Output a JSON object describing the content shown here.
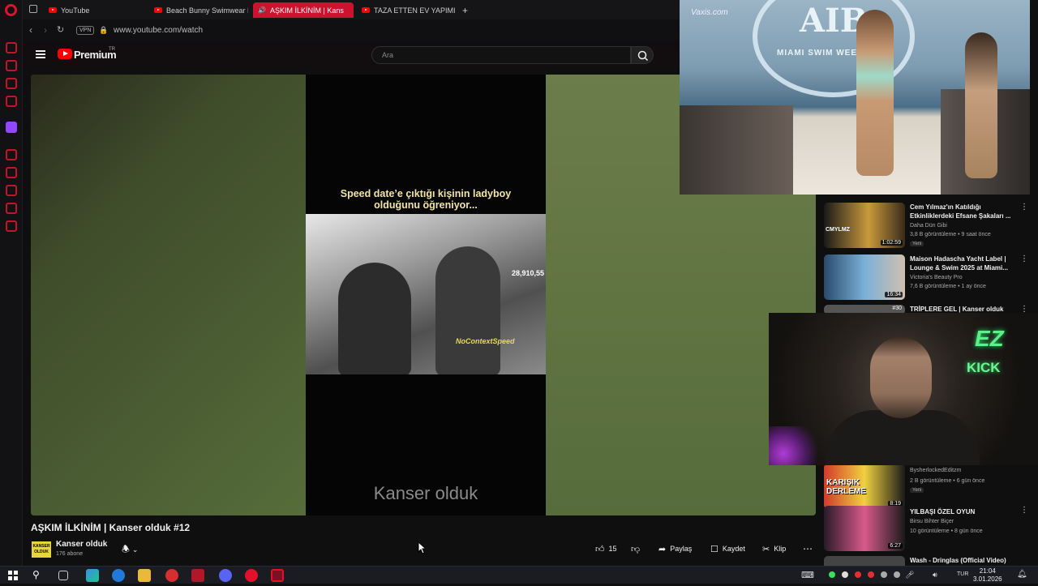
{
  "browser": {
    "tabs": [
      {
        "label": "YouTube",
        "active": false
      },
      {
        "label": "Beach Bunny Swimwear F",
        "active": false
      },
      {
        "label": "AŞKIM İLKİNİM | Kans",
        "active": true
      },
      {
        "label": "TAZA ETTEN EV YAPIMI KC",
        "active": false
      }
    ],
    "new_tab_label": "+",
    "vpn_label": "VPN",
    "url": "www.youtube.com/watch"
  },
  "youtube": {
    "logo_text": "Premium",
    "logo_region": "TR",
    "search_placeholder": "Ara"
  },
  "video": {
    "caption_line1": "Speed date’e çıktığı kişinin ladyboy",
    "caption_line2": "olduğunu öğreniyor...",
    "counter": "28,910,55",
    "overlay_tag": "NoContextSpeed",
    "watermark": "Kanser olduk",
    "title": "AŞKIM İLKİNİM | Kanser olduk #12",
    "channel_name": "Kanser olduk",
    "channel_avatar_text": "KANSER OLDUK",
    "subscribers": "176 abone",
    "likes": "15",
    "share_label": "Paylaş",
    "save_label": "Kaydet",
    "clip_label": "Klip"
  },
  "pip": {
    "banner_text": "AIB",
    "banner_subtext": "MIAMI SWIM WEEK",
    "source_logo": "Vaxis.com"
  },
  "webcam": {
    "overlay_line1": "EZ",
    "overlay_line2": "KICK"
  },
  "recommendations": [
    {
      "title": "Cem Yılmaz'ın Katıldığı Etkinliklerdeki Efsane Şakaları ...",
      "channel": "Daha Dün Gibi",
      "meta": "3,8 B görüntüleme • 9 saat önce",
      "badge": "Yeni",
      "duration": "1:02:59",
      "thumb_text": "CMYLMZ"
    },
    {
      "title": "Maison Hadascha Yacht Label | Lounge & Swim 2025 at Miami...",
      "channel": "Victoria's Beauty Pro",
      "meta": "7,6 B görüntüleme • 1 ay önce",
      "badge": "",
      "duration": "16:34",
      "thumb_text": ""
    },
    {
      "title": "TRİPLERE GEL | Kanser olduk",
      "channel": "",
      "meta": "",
      "badge": "",
      "duration": "",
      "thumb_text": "#30"
    },
    {
      "title": "",
      "channel": "BysherlockedEditzm",
      "meta": "2 B görüntüleme • 6 gün önce",
      "badge": "Yeni",
      "duration": "8:19",
      "thumb_text": "KARIŞIK DERLEME"
    },
    {
      "title": "YILBAŞI ÖZEL OYUN",
      "channel": "Birsu Bihter Biçer",
      "meta": "10 görüntüleme • 8 gün önce",
      "badge": "",
      "duration": "6:27",
      "thumb_text": ""
    },
    {
      "title": "Wash - Dringlas (Official Video)",
      "channel": "",
      "meta": "",
      "badge": "",
      "duration": "",
      "thumb_text": ""
    }
  ],
  "taskbar": {
    "language": "TUR",
    "time": "21:04",
    "date": "3.01.2026"
  },
  "icons": [
    "opera-logo-icon",
    "back-arrow-icon",
    "forward-arrow-icon",
    "reload-icon",
    "lock-icon",
    "menu-icon",
    "search-icon",
    "bell-icon",
    "chevron-down-icon",
    "like-icon",
    "dislike-icon",
    "share-icon",
    "save-icon",
    "scissors-icon",
    "more-icon",
    "windows-start-icon"
  ],
  "colors": {
    "accent": "#c8142f",
    "youtube_red": "#ff0000",
    "kick_green": "#5cf08a"
  }
}
